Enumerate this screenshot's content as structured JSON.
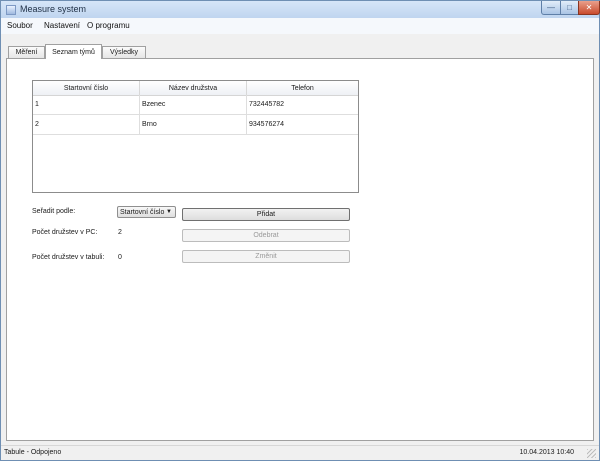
{
  "window": {
    "title": "Measure system",
    "minimize_glyph": "—",
    "maximize_glyph": "□",
    "close_glyph": "✕"
  },
  "menu": [
    {
      "label": "Soubor"
    },
    {
      "label": "Nastavení"
    },
    {
      "label": "O programu"
    }
  ],
  "tabs": [
    {
      "label": "Měření"
    },
    {
      "label": "Seznam týmů",
      "active": true
    },
    {
      "label": "Výsledky"
    }
  ],
  "table": {
    "columns": [
      "Startovní číslo",
      "Název družstva",
      "Telefon"
    ],
    "rows": [
      [
        "1",
        "Bzenec",
        "732445782"
      ],
      [
        "2",
        "Brno",
        "934576274"
      ]
    ]
  },
  "controls": {
    "sort_label": "Seřadit podle:",
    "sort_value": "Startovní číslo",
    "add_button": "Přidat",
    "remove_button": "Odebrat",
    "change_button": "Změnit",
    "teams_pc_label": "Počet družstev v PC:",
    "teams_pc_value": "2",
    "teams_board_label": "Počet družstev v tabuli:",
    "teams_board_value": "0"
  },
  "status": {
    "left": "Tabule - Odpojeno",
    "datetime": "10.04.2013 10:40"
  },
  "icons": {
    "app": "window-app-icon",
    "dropdown": "chevron-down-icon",
    "resize": "resize-grip-icon"
  }
}
